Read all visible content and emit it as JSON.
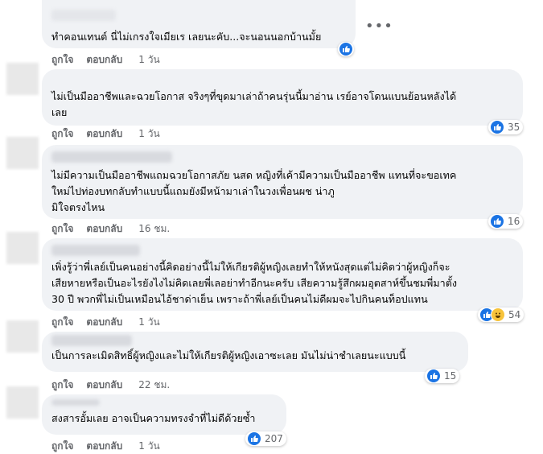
{
  "comments": [
    {
      "text": "ทำคอนเทนต์ นี่ไม่เกรงใจเมียเร เลยนะคับ...จะนอนนอกบ้านมั้ย",
      "like_label": "ถูกใจ",
      "reply_label": "ตอบกลับ",
      "time": "1 วัน",
      "reaction_count": ""
    },
    {
      "text": "ไม่เป็นมืออาชีพและฉวยโอกาส จริงๆที่ขุดมาเล่าถ้าคนรุ่นนี้มาอ่าน เรย์อาจโดนแบนย้อนหลังได้\nเลย",
      "like_label": "ถูกใจ",
      "reply_label": "ตอบกลับ",
      "time": "1 วัน",
      "reaction_count": "35"
    },
    {
      "text": "ไม่มีความเป็นมืออาชีพแถมฉวยโอกาสภัย นสด หญิงที่เค้ามีความเป็นมืออาชีพ แทนที่จะขอเทค\nใหม่ไปท่องบทกลับทำแบบนี้แถมยังมีหน้ามาเล่าในวงเพื่อนผช น่าภู\nมิใจตรงไหน",
      "like_label": "ถูกใจ",
      "reply_label": "ตอบกลับ",
      "time": "16 ชม.",
      "reaction_count": "16"
    },
    {
      "text": "เพิ่งรู้ว่าพี่เลย์เป็นคนอย่างนี้คิดอย่างนี้ไม่ให้เกียรติผู้หญิงเลยทำให้หนังสุดแต่ไม่คิดว่าผู้หญิงก็จะ\nเสียหายหรือเป็นอะไรยังไงไม่คิดเลยพี่เลอย่าทำอีกนะครับ เสียความรู้สึกผมอุตสาห์ขึ้นชมพี่มาตั้ง\n30 ปี พวกพี่ไม่เป็นเหมือนไอ้ชาด่าเย็น เพราะถ้าพี่เลย์เป็นคนไม่ดีผมจะไปกินคนท็อปแทน",
      "like_label": "ถูกใจ",
      "reply_label": "ตอบกลับ",
      "time": "1 วัน",
      "reaction_count": "54"
    },
    {
      "text": "เป็นการละเมิดสิทธิ์ผู้หญิงและไม่ให้เกียรติผู้หญิงเอาซะเลย มันไม่น่าชำเลยนะแบบนี้",
      "like_label": "ถูกใจ",
      "reply_label": "ตอบกลับ",
      "time": "22 ชม.",
      "reaction_count": "15"
    },
    {
      "text": "สงสารอั้มเลย อาจเป็นความทรงจำที่ไม่ดีด้วยซ้ำ",
      "like_label": "ถูกใจ",
      "reply_label": "ตอบกลับ",
      "time": "1 วัน",
      "reaction_count": "207"
    }
  ],
  "colors": {
    "like_blue": "#1b74e4",
    "bubble_bg": "#f0f2f5",
    "meta_text": "#65676b"
  }
}
